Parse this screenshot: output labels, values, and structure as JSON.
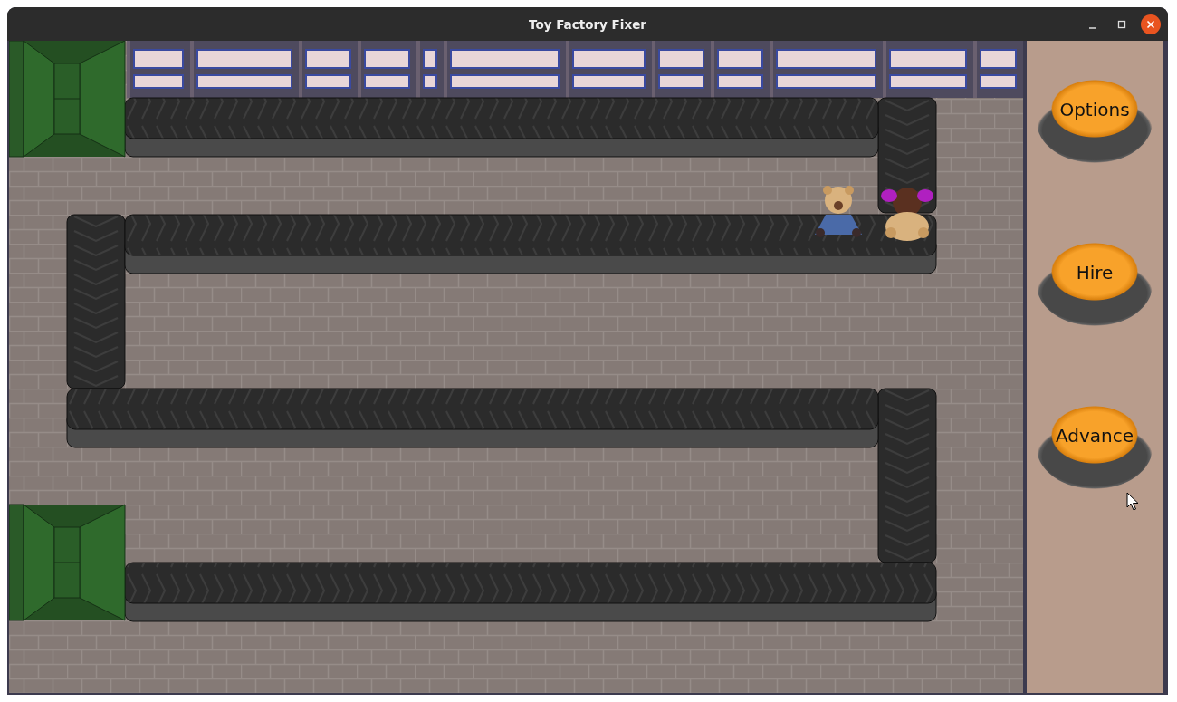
{
  "window": {
    "title": "Toy Factory Fixer"
  },
  "sidebar": {
    "buttons": [
      {
        "label": "Options"
      },
      {
        "label": "Hire"
      },
      {
        "label": "Advance"
      }
    ]
  }
}
